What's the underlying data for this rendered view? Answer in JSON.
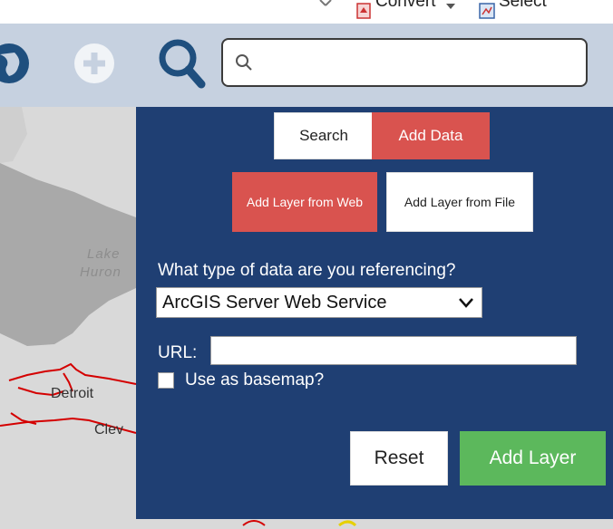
{
  "toolbar": {
    "convert_label": "Convert",
    "select_label": "Select",
    "search_placeholder": ""
  },
  "map": {
    "labels": [
      "Lake",
      "Huron",
      "Detroit",
      "Clev"
    ]
  },
  "panel": {
    "tabs": [
      {
        "label": "Search",
        "active": false
      },
      {
        "label": "Add Data",
        "active": true
      }
    ],
    "subtabs": [
      {
        "label": "Add Layer from Web",
        "active": true
      },
      {
        "label": "Add Layer from File",
        "active": false
      }
    ],
    "data_type_question": "What type of data are you referencing?",
    "data_type_selected": "ArcGIS Server Web Service",
    "url_label": "URL:",
    "url_value": "",
    "basemap_label": "Use as basemap?",
    "reset_label": "Reset",
    "add_layer_label": "Add Layer"
  },
  "colors": {
    "panel_bg": "#1f3f73",
    "accent_red": "#d9534f",
    "success_green": "#5cb85c",
    "toolbar_bg": "#c6d1e0",
    "icon_blue": "#1f4f7e"
  }
}
